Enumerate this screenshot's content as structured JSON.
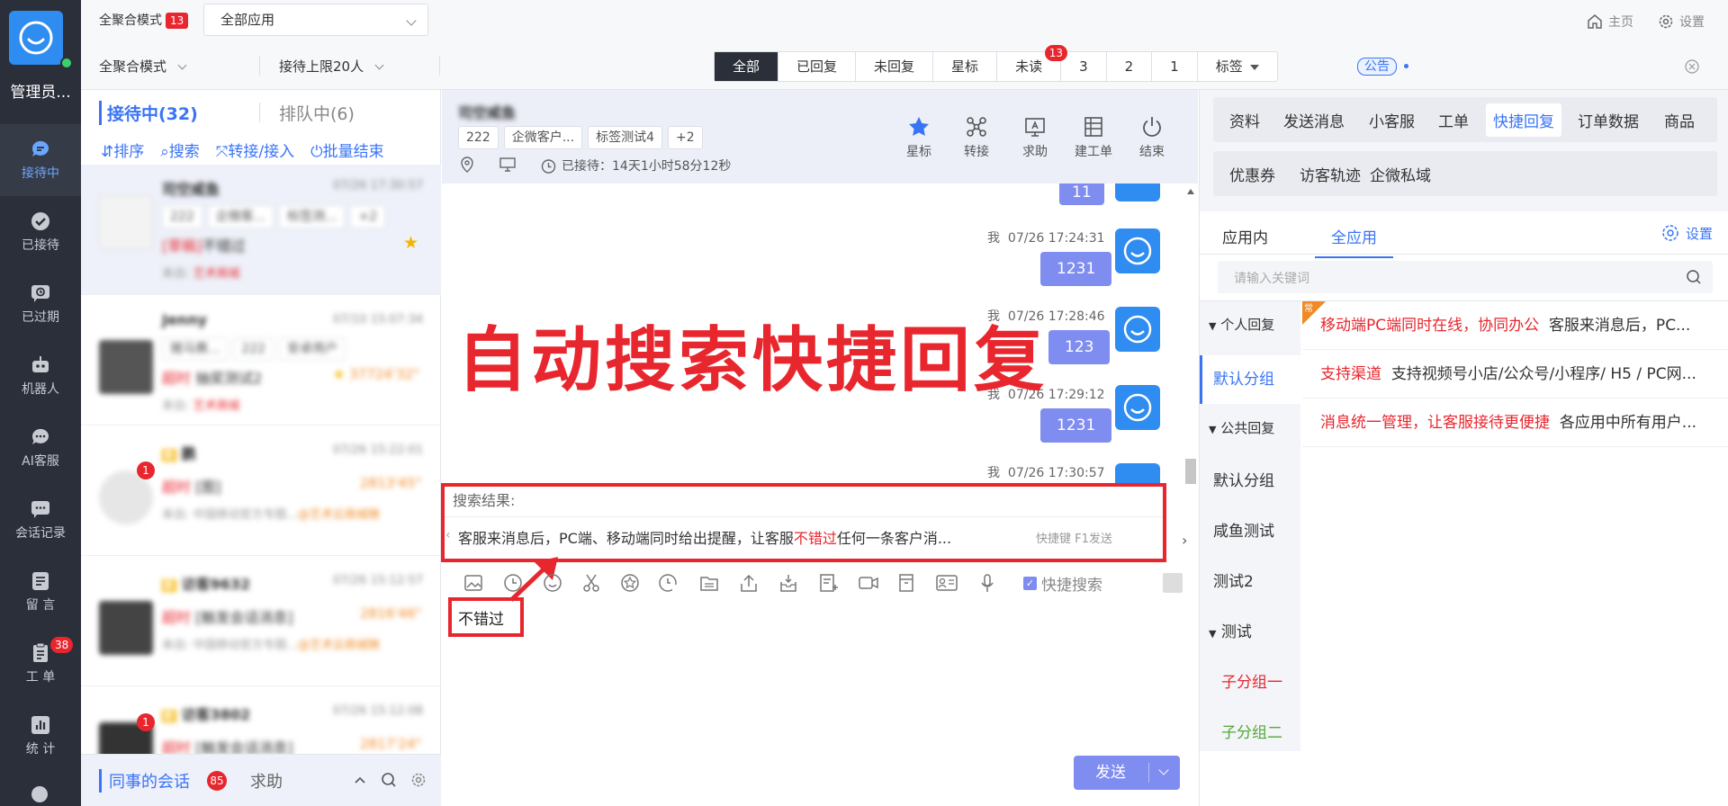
{
  "nav": {
    "user": "管理员...",
    "items": [
      {
        "label": "接待中"
      },
      {
        "label": "已接待"
      },
      {
        "label": "已过期"
      },
      {
        "label": "机器人"
      },
      {
        "label": "AI客服"
      },
      {
        "label": "会话记录"
      },
      {
        "label": "留 言"
      },
      {
        "label": "工 单",
        "badge": "38"
      },
      {
        "label": "统 计"
      }
    ]
  },
  "top": {
    "mode_label": "全聚合模式",
    "mode_badge": "13",
    "app_select": "全部应用",
    "mode_select": "全聚合模式",
    "limit_select": "接待上限20人",
    "filters": [
      "全部",
      "已回复",
      "未回复",
      "星标",
      "未读",
      "3",
      "2",
      "1",
      "标签"
    ],
    "unread_badge": "13",
    "notice": "公告",
    "home": "主页",
    "settings": "设置"
  },
  "sessions": {
    "tab_active": "接待中(32)",
    "tab_queue": "排队中(6)",
    "actions": [
      "排序",
      "搜索",
      "转接/接入",
      "批量结束"
    ],
    "list": [
      {
        "name": "司空咸鱼",
        "time": "07/26 17:30:57",
        "tags": [
          "222",
          "企微客...",
          "标签测...",
          "+2"
        ],
        "preview_status": "[草稿]",
        "preview": "不错过",
        "source": "来自:",
        "source_name": "艺术商城"
      },
      {
        "name": "Jenny",
        "time": "07/10 15:07:34",
        "tags": [
          "猪马赛...",
          "222",
          "安卓用户"
        ],
        "preview_status": "超时",
        "preview": "抽奖测试2",
        "duration": "37724'32\"",
        "source": "来自:",
        "source_name": "艺术商城"
      },
      {
        "name": "鹏",
        "time": "07/26 15:22:01",
        "tags": [],
        "preview_status": "超时",
        "preview": "[图]",
        "duration": "2813'45\"",
        "source": "来自: 中国移动官方专题...",
        "source_name": "@艺术云商城微",
        "badge": "1",
        "tag_new": "新"
      },
      {
        "name": "访客9632",
        "time": "07/26 15:12:57",
        "tags": [],
        "preview_status": "超时",
        "preview": "[触发会话消息]",
        "duration": "2816'46\"",
        "source": "来自: 中国移动官方专题...",
        "source_name": "@艺术云商城微",
        "tag_new": "新"
      },
      {
        "name": "访客3802",
        "time": "07/26 15:12:08",
        "tags": [],
        "preview_status": "超时",
        "preview": "[触发会话消息]",
        "duration": "2817'24\"",
        "badge": "1",
        "tag_new": "新"
      }
    ],
    "footer_colleague": "同事的会话",
    "footer_badge": "85",
    "footer_help": "求助"
  },
  "chat": {
    "name": "司空咸鱼",
    "tags": [
      "222",
      "企微客户...",
      "标签测试4",
      "+2"
    ],
    "waited": "已接待：14天1小时58分12秒",
    "header_buttons": [
      "星标",
      "转接",
      "求助",
      "建工单",
      "结束"
    ],
    "messages": [
      {
        "sender": "我",
        "time": "07/26 17:24:31",
        "text": "1231"
      },
      {
        "sender": "我",
        "time": "07/26 17:28:46",
        "text": "123"
      },
      {
        "sender": "我",
        "time": "07/26 17:29:12",
        "text": "1231"
      },
      {
        "sender": "我",
        "time": "07/26 17:30:57",
        "text": ""
      }
    ],
    "first_bubble": "11",
    "search_title": "搜索结果:",
    "search_before": "客服来消息后，PC端、移动端同时给出提醒，让客服",
    "search_hit": "不错过",
    "search_after": "任何一条客户消...",
    "search_hint": "快捷键 F1发送",
    "quick_search": "快捷搜索",
    "input_value": "不错过",
    "send": "发送",
    "overlay_title": "自动搜索快捷回复"
  },
  "right": {
    "tabs_row1": [
      "资料",
      "发送消息",
      "小客服",
      "工单",
      "快捷回复",
      "订单数据",
      "商品"
    ],
    "tabs_row2": [
      "优惠券",
      "访客轨迹",
      "企微私域"
    ],
    "sub_tabs": [
      "应用内",
      "全应用"
    ],
    "settings": "设置",
    "search_placeholder": "请输入关键词",
    "groups": [
      {
        "label": "个人回复",
        "type": "header"
      },
      {
        "label": "默认分组",
        "type": "active"
      },
      {
        "label": "公共回复",
        "type": "header"
      },
      {
        "label": "默认分组",
        "type": "item"
      },
      {
        "label": "咸鱼测试",
        "type": "item"
      },
      {
        "label": "测试2",
        "type": "item"
      },
      {
        "label": "测试",
        "type": "header2"
      },
      {
        "label": "子分组一",
        "type": "sub-red"
      },
      {
        "label": "子分组二",
        "type": "sub-green"
      }
    ],
    "replies": [
      {
        "title": "移动端PC端同时在线，协同办公",
        "content": "客服来消息后，PC...",
        "tag": "常"
      },
      {
        "title": "支持渠道",
        "content": "支持视频号小店/公众号/小程序/ H5 / PC网..."
      },
      {
        "title": "消息统一管理，让客服接待更便捷",
        "content": "各应用中所有用户..."
      }
    ]
  }
}
